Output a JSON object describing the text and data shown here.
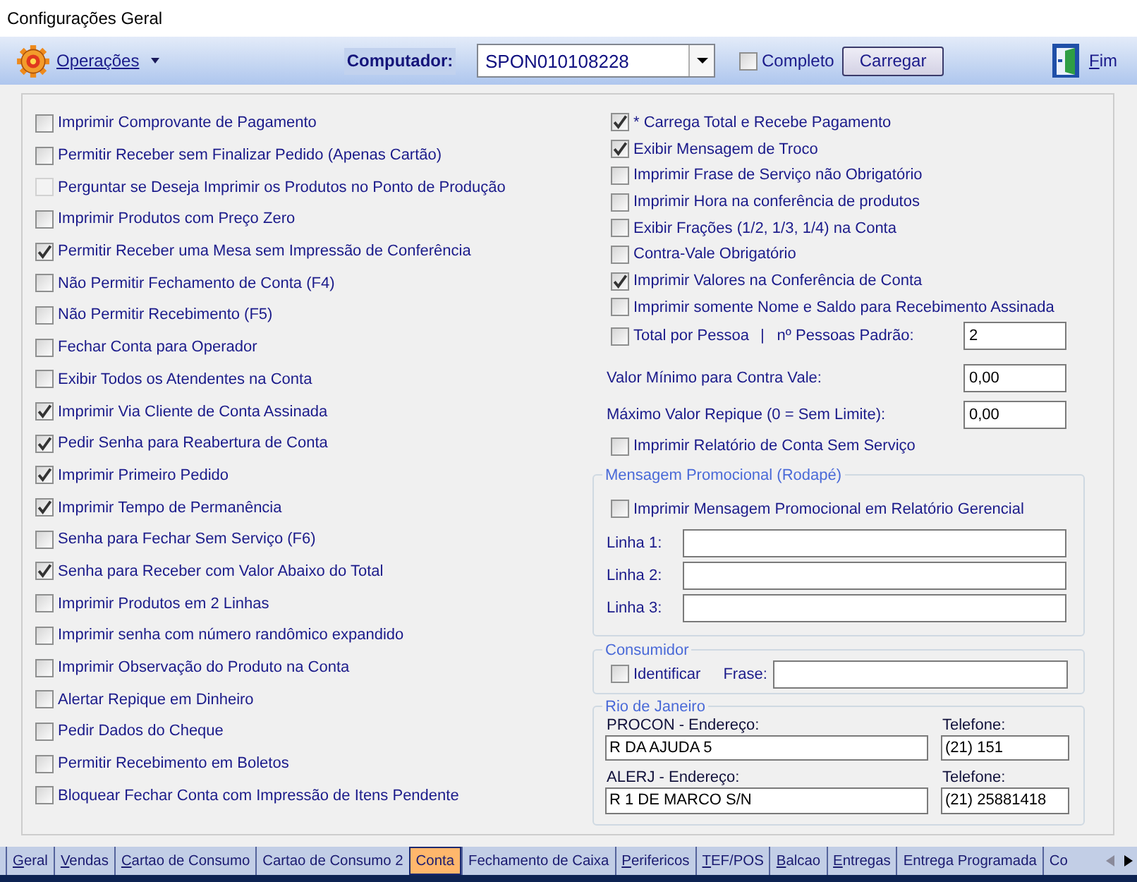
{
  "window": {
    "title": "Configurações Geral"
  },
  "toolbar": {
    "operations_menu": "Operações",
    "computer": {
      "label": "Computador:",
      "value": "SPON010108228"
    },
    "complete": {
      "label": "Completo",
      "checked": false
    },
    "load_button": "Carregar",
    "exit_button": {
      "label": "Fim",
      "mnemonic": true
    }
  },
  "left_options": [
    {
      "label": "Imprimir Comprovante de Pagamento",
      "checked": false,
      "disabled": false
    },
    {
      "label": "Permitir Receber sem Finalizar Pedido (Apenas Cartão)",
      "checked": false,
      "disabled": false
    },
    {
      "label": "Perguntar se Deseja Imprimir os Produtos no Ponto de Produção",
      "checked": false,
      "disabled": true
    },
    {
      "label": "Imprimir Produtos com Preço Zero",
      "checked": false,
      "disabled": false
    },
    {
      "label": "Permitir Receber uma Mesa sem Impressão de Conferência",
      "checked": true,
      "disabled": false
    },
    {
      "label": "Não Permitir Fechamento de Conta (F4)",
      "checked": false,
      "disabled": false
    },
    {
      "label": "Não Permitir Recebimento (F5)",
      "checked": false,
      "disabled": false
    },
    {
      "label": "Fechar Conta para Operador",
      "checked": false,
      "disabled": false
    },
    {
      "label": "Exibir Todos os Atendentes na Conta",
      "checked": false,
      "disabled": false
    },
    {
      "label": "Imprimir Via Cliente de Conta Assinada",
      "checked": true,
      "disabled": false
    },
    {
      "label": "Pedir Senha para Reabertura de Conta",
      "checked": true,
      "disabled": false
    },
    {
      "label": "Imprimir Primeiro Pedido",
      "checked": true,
      "disabled": false
    },
    {
      "label": "Imprimir Tempo de Permanência",
      "checked": true,
      "disabled": false
    },
    {
      "label": "Senha para Fechar Sem Serviço (F6)",
      "checked": false,
      "disabled": false
    },
    {
      "label": "Senha para Receber com Valor Abaixo do Total",
      "checked": true,
      "disabled": false
    },
    {
      "label": "Imprimir Produtos em 2 Linhas",
      "checked": false,
      "disabled": false
    },
    {
      "label": "Imprimir senha com número randômico expandido",
      "checked": false,
      "disabled": false
    },
    {
      "label": "Imprimir Observação do Produto na Conta",
      "checked": false,
      "disabled": false
    },
    {
      "label": "Alertar Repique em Dinheiro",
      "checked": false,
      "disabled": false
    },
    {
      "label": "Pedir Dados do Cheque",
      "checked": false,
      "disabled": false
    },
    {
      "label": "Permitir Recebimento em Boletos",
      "checked": false,
      "disabled": false
    },
    {
      "label": "Bloquear Fechar Conta com Impressão de Itens Pendente",
      "checked": false,
      "disabled": false
    }
  ],
  "right_options": [
    {
      "kind": "checkbox",
      "label": "* Carrega Total e Recebe Pagamento",
      "checked": true
    },
    {
      "kind": "checkbox",
      "label": "Exibir Mensagem de Troco",
      "checked": true
    },
    {
      "kind": "checkbox",
      "label": "Imprimir Frase de Serviço não Obrigatório",
      "checked": false
    },
    {
      "kind": "checkbox",
      "label": "Imprimir Hora na conferência de produtos",
      "checked": false
    },
    {
      "kind": "checkbox",
      "label": "Exibir Frações (1/2, 1/3, 1/4) na Conta",
      "checked": false
    },
    {
      "kind": "checkbox",
      "label": "Contra-Vale Obrigatório",
      "checked": false
    },
    {
      "kind": "checkbox",
      "label": "Imprimir Valores na Conferência de Conta",
      "checked": true
    },
    {
      "kind": "checkbox",
      "label": "Imprimir somente Nome e Saldo para Recebimento Assinada",
      "checked": false
    },
    {
      "kind": "checkbox_field",
      "label": "Total por Pessoa",
      "checked": false,
      "separator": "|",
      "field_label": "nº Pessoas Padrão:",
      "value": "2"
    },
    {
      "kind": "field",
      "label": "Valor Mínimo para Contra Vale:",
      "value": "0,00"
    },
    {
      "kind": "field",
      "label": "Máximo Valor Repique (0 = Sem Limite):",
      "value": "0,00"
    },
    {
      "kind": "checkbox",
      "label": "Imprimir Relatório de Conta Sem Serviço",
      "checked": false
    }
  ],
  "promo_group": {
    "title": "Mensagem Promocional (Rodapé)",
    "option": {
      "label": "Imprimir Mensagem Promocional em Relatório Gerencial",
      "checked": false
    },
    "lines": [
      {
        "label": "Linha 1:"
      },
      {
        "label": "Linha 2:"
      },
      {
        "label": "Linha 3:"
      }
    ]
  },
  "consumer_group": {
    "title": "Consumidor",
    "option": {
      "label": "Identificar",
      "checked": false
    },
    "phrase": {
      "label": "Frase:"
    }
  },
  "rio_group": {
    "title": "Rio de Janeiro",
    "contacts": [
      {
        "address_label": "PROCON - Endereço:",
        "address": "R DA AJUDA 5",
        "phone_label": "Telefone:",
        "phone": "(21) 151"
      },
      {
        "address_label": "ALERJ - Endereço:",
        "address": "R 1 DE MARCO S/N",
        "phone_label": "Telefone:",
        "phone": "(21) 25881418"
      }
    ]
  },
  "tabs": [
    {
      "label": "Geral",
      "selected": false,
      "mnemonic": true
    },
    {
      "label": "Vendas",
      "selected": false,
      "mnemonic": true
    },
    {
      "label": "Cartao de Consumo",
      "selected": false,
      "mnemonic": true
    },
    {
      "label": "Cartao de Consumo 2",
      "selected": false,
      "mnemonic": false
    },
    {
      "label": "Conta",
      "selected": true,
      "mnemonic": false
    },
    {
      "label": "Fechamento de Caixa",
      "selected": false,
      "mnemonic": false
    },
    {
      "label": "Perifericos",
      "selected": false,
      "mnemonic": true
    },
    {
      "label": "TEF/POS",
      "selected": false,
      "mnemonic": true
    },
    {
      "label": "Balcao",
      "selected": false,
      "mnemonic": true
    },
    {
      "label": "Entregas",
      "selected": false,
      "mnemonic": true
    },
    {
      "label": "Entrega Programada",
      "selected": false,
      "mnemonic": false
    },
    {
      "label": "Co",
      "selected": false,
      "mnemonic": false
    }
  ]
}
